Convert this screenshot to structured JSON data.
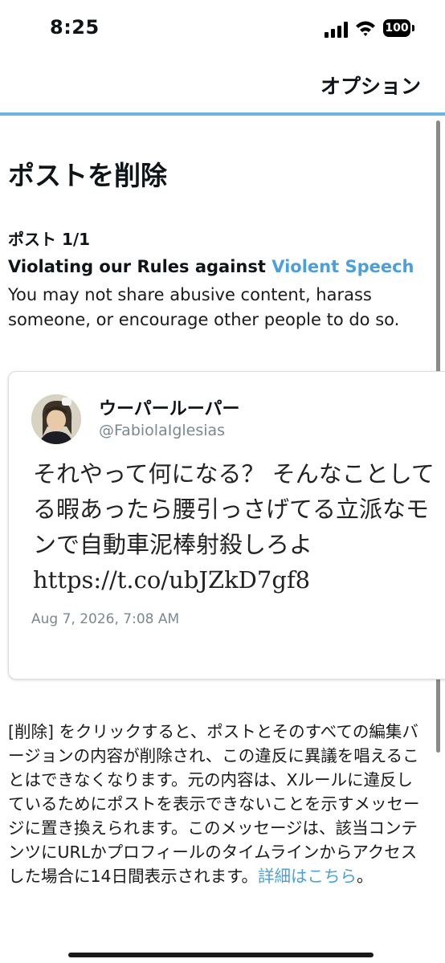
{
  "status_bar": {
    "time": "8:25",
    "battery": "100"
  },
  "nav": {
    "options_label": "オプション"
  },
  "page": {
    "title": "ポストを削除",
    "post_counter": "ポスト 1/1",
    "rule_prefix": "Violating our Rules against ",
    "rule_link": "Violent Speech",
    "rule_description": "You may not share abusive content, harass someone, or encourage other people to do so."
  },
  "tweet": {
    "display_name": "ウーパールーパー",
    "handle": "@FabiolaIglesias",
    "text": "それやって何になる？ そんなことしてる暇あったら腰引っさげてる立派なモンで自動車泥棒射殺しろよ",
    "url": "https://t.co/ubJZkD7gf8",
    "timestamp": "Aug 7, 2026, 7:08 AM"
  },
  "explanation": {
    "text": "[削除] をクリックすると、ポストとそのすべての編集バージョンの内容が削除され、この違反に異議を唱えることはできなくなります。元の内容は、Xルールに違反しているためにポストを表示できないことを示すメッセージに置き換えられます。このメッセージは、該当コンテンツにURLかプロフィールのタイムラインからアクセスした場合に14日間表示されます。",
    "link": "詳細はこちら",
    "end": "。"
  },
  "colors": {
    "accent": "#4a9fdc",
    "divider": "#6cb4e4"
  }
}
